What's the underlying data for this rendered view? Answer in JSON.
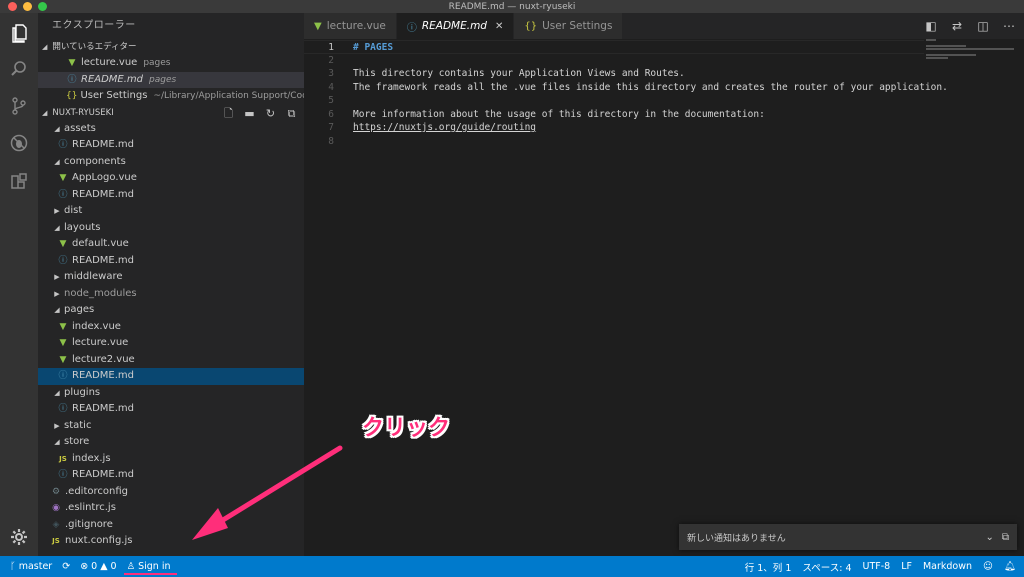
{
  "window": {
    "title": "README.md — nuxt-ryuseki"
  },
  "sidebar": {
    "title": "エクスプローラー",
    "open_editors": {
      "header": "開いているエディター",
      "items": [
        {
          "name": "lecture.vue",
          "desc": "pages",
          "icon": "vue-icon"
        },
        {
          "name": "README.md",
          "desc": "pages",
          "icon": "info-icon"
        },
        {
          "name": "User Settings",
          "desc": "~/Library/Application Support/Code...",
          "icon": "json-icon"
        }
      ]
    },
    "project": {
      "header": "NUXT-RYUSEKI",
      "tree": [
        {
          "label": "assets",
          "type": "folder-open"
        },
        {
          "label": "README.md",
          "type": "md",
          "depth": 1
        },
        {
          "label": "components",
          "type": "folder-open"
        },
        {
          "label": "AppLogo.vue",
          "type": "vue",
          "depth": 1
        },
        {
          "label": "README.md",
          "type": "md",
          "depth": 1
        },
        {
          "label": "dist",
          "type": "folder-closed"
        },
        {
          "label": "layouts",
          "type": "folder-open"
        },
        {
          "label": "default.vue",
          "type": "vue",
          "depth": 1
        },
        {
          "label": "README.md",
          "type": "md",
          "depth": 1
        },
        {
          "label": "middleware",
          "type": "folder-closed"
        },
        {
          "label": "node_modules",
          "type": "folder-closed"
        },
        {
          "label": "pages",
          "type": "folder-open"
        },
        {
          "label": "index.vue",
          "type": "vue",
          "depth": 1
        },
        {
          "label": "lecture.vue",
          "type": "vue",
          "depth": 1
        },
        {
          "label": "lecture2.vue",
          "type": "vue",
          "depth": 1
        },
        {
          "label": "README.md",
          "type": "md",
          "depth": 1,
          "selected": true
        },
        {
          "label": "plugins",
          "type": "folder-open"
        },
        {
          "label": "README.md",
          "type": "md",
          "depth": 1
        },
        {
          "label": "static",
          "type": "folder-closed"
        },
        {
          "label": "store",
          "type": "folder-open"
        },
        {
          "label": "index.js",
          "type": "js",
          "depth": 1
        },
        {
          "label": "README.md",
          "type": "md",
          "depth": 1
        },
        {
          "label": ".editorconfig",
          "type": "config"
        },
        {
          "label": ".eslintrc.js",
          "type": "eslint"
        },
        {
          "label": ".gitignore",
          "type": "git"
        },
        {
          "label": "nuxt.config.js",
          "type": "js"
        }
      ]
    }
  },
  "tabs": [
    {
      "label": "lecture.vue",
      "icon": "vue-icon",
      "active": false
    },
    {
      "label": "README.md",
      "icon": "info-icon",
      "active": true
    },
    {
      "label": "User Settings",
      "icon": "json-icon",
      "active": false
    }
  ],
  "editor": {
    "lines": [
      {
        "n": "1",
        "text": "# PAGES",
        "kind": "heading"
      },
      {
        "n": "2",
        "text": "",
        "kind": "text"
      },
      {
        "n": "3",
        "text": "This directory contains your Application Views and Routes.",
        "kind": "text"
      },
      {
        "n": "4",
        "text": "The framework reads all the .vue files inside this directory and creates the router of your application.",
        "kind": "text"
      },
      {
        "n": "5",
        "text": "",
        "kind": "text"
      },
      {
        "n": "6",
        "text": "More information about the usage of this directory in the documentation:",
        "kind": "text"
      },
      {
        "n": "7",
        "text": "https://nuxtjs.org/guide/routing",
        "kind": "link"
      },
      {
        "n": "8",
        "text": "",
        "kind": "text"
      }
    ]
  },
  "annotation": {
    "text": "クリック",
    "color": "#ff2e7a"
  },
  "notification": {
    "text": "新しい通知はありません"
  },
  "statusbar": {
    "branch": "master",
    "errors": "0",
    "warnings": "0",
    "signin": "Sign in",
    "position": "行 1、列 1",
    "spaces": "スペース: 4",
    "encoding": "UTF-8",
    "eol": "LF",
    "language": "Markdown"
  },
  "colors": {
    "accent": "#007acc",
    "selection": "#094771"
  }
}
